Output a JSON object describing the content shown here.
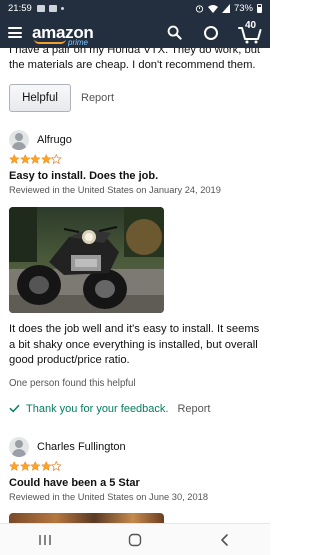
{
  "status_bar": {
    "time": "21:59",
    "battery": "73%"
  },
  "header": {
    "logo_text": "amazon",
    "logo_sub": "prime",
    "cart_count": "40",
    "icons": [
      "menu-icon",
      "search-icon",
      "alexa-icon",
      "cart-icon"
    ]
  },
  "previous_review": {
    "text": "I have a pair on my Honda VTX. They do work, but the materials are cheap. I don't recommend them.",
    "helpful_label": "Helpful",
    "report_label": "Report"
  },
  "reviews": [
    {
      "reviewer": "Alfrugo",
      "rating": 4,
      "title": "Easy to install. Does the job.",
      "meta": "Reviewed in the United States on January 24, 2019",
      "body": "It does the job well and it's easy to install. It seems a bit shaky once everything is installed, but overall good product/price ratio.",
      "found_helpful": "One person found this helpful",
      "feedback": "Thank you for your feedback.",
      "report_label": "Report"
    },
    {
      "reviewer": "Charles Fullington",
      "rating": 4,
      "title": "Could have been a 5 Star",
      "meta": "Reviewed in the United States on June 30, 2018"
    }
  ],
  "colors": {
    "header_bg": "#232f3e",
    "star": "#ffa41c",
    "feedback_green": "#067d62",
    "smile": "#f0a030"
  }
}
